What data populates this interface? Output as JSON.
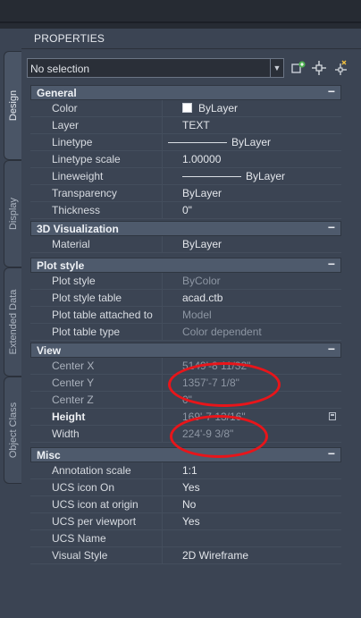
{
  "panel": {
    "title": "PROPERTIES"
  },
  "tabs": [
    {
      "label": "Design",
      "active": true
    },
    {
      "label": "Display",
      "active": false
    },
    {
      "label": "Extended Data",
      "active": false
    },
    {
      "label": "Object Class",
      "active": false
    }
  ],
  "selection": {
    "value": "No selection"
  },
  "toolbar": {
    "icons": [
      "quick-select-icon",
      "select-objects-icon",
      "toggle-pickadd-icon"
    ]
  },
  "sections": {
    "general": {
      "title": "General",
      "collapse": "−",
      "rows": {
        "color": {
          "label": "Color",
          "value": "ByLayer"
        },
        "layer": {
          "label": "Layer",
          "value": "TEXT"
        },
        "linetype": {
          "label": "Linetype",
          "value": "ByLayer"
        },
        "linetype_scale": {
          "label": "Linetype scale",
          "value": "1.00000"
        },
        "lineweight": {
          "label": "Lineweight",
          "value": "ByLayer"
        },
        "transparency": {
          "label": "Transparency",
          "value": "ByLayer"
        },
        "thickness": {
          "label": "Thickness",
          "value": "0\""
        }
      }
    },
    "viz3d": {
      "title": "3D Visualization",
      "collapse": "−",
      "rows": {
        "material": {
          "label": "Material",
          "value": "ByLayer"
        }
      }
    },
    "plot": {
      "title": "Plot style",
      "collapse": "−",
      "rows": {
        "plot_style": {
          "label": "Plot style",
          "value": "ByColor"
        },
        "plot_style_table": {
          "label": "Plot style table",
          "value": "acad.ctb"
        },
        "plot_table_attached": {
          "label": "Plot table attached to",
          "value": "Model"
        },
        "plot_table_type": {
          "label": "Plot table type",
          "value": "Color dependent"
        }
      }
    },
    "view": {
      "title": "View",
      "collapse": "−",
      "rows": {
        "center_x": {
          "label": "Center X",
          "value": "5149'-8 11/32\""
        },
        "center_y": {
          "label": "Center Y",
          "value": "1357'-7 1/8\""
        },
        "center_z": {
          "label": "Center Z",
          "value": "0\""
        },
        "height": {
          "label": "Height",
          "value": "169'-7 13/16\""
        },
        "width": {
          "label": "Width",
          "value": "224'-9 3/8\""
        }
      }
    },
    "misc": {
      "title": "Misc",
      "collapse": "−",
      "rows": {
        "annotation_scale": {
          "label": "Annotation scale",
          "value": "1:1"
        },
        "ucs_icon_on": {
          "label": "UCS icon On",
          "value": "Yes"
        },
        "ucs_icon_origin": {
          "label": "UCS icon at origin",
          "value": "No"
        },
        "ucs_per_viewport": {
          "label": "UCS per viewport",
          "value": "Yes"
        },
        "ucs_name": {
          "label": "UCS Name",
          "value": ""
        },
        "visual_style": {
          "label": "Visual Style",
          "value": "2D Wireframe"
        }
      }
    }
  },
  "colors": {
    "annotation": "#e8151a",
    "section_header": "#4e5a6c",
    "panel_bg": "#3b4453"
  }
}
